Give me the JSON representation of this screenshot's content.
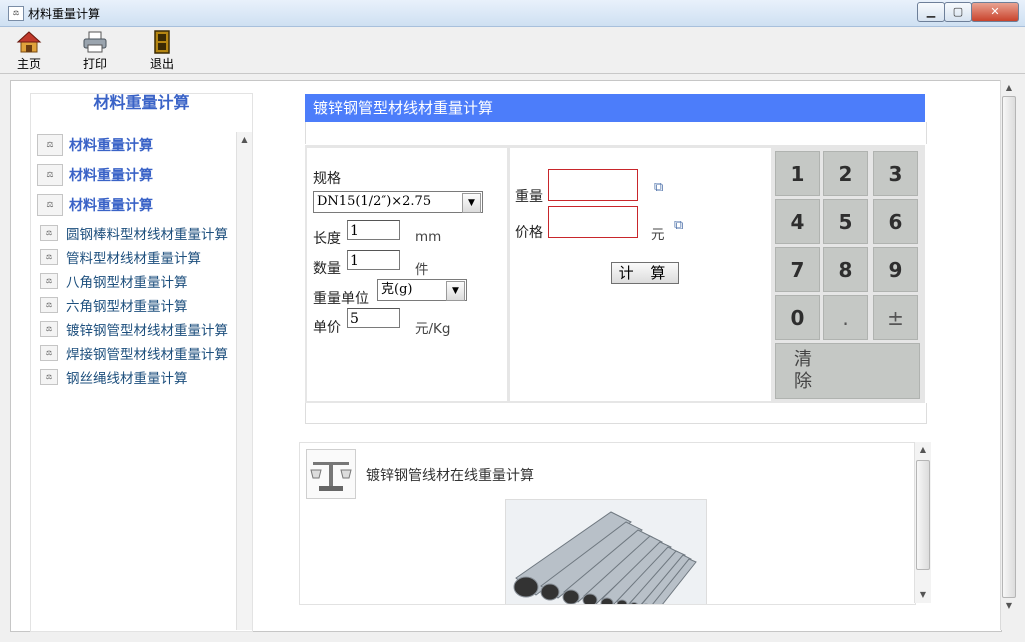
{
  "window": {
    "title": "材料重量计算",
    "app_icon": "scale-icon",
    "buttons": [
      "minimize-icon",
      "maximize-icon",
      "close-icon"
    ]
  },
  "toolbar": {
    "home_label": "主页",
    "print_label": "打印",
    "exit_label": "退出"
  },
  "sidebar": {
    "title": "材料重量计算",
    "items": [
      {
        "label": "材料重量计算",
        "size": "large"
      },
      {
        "label": "材料重量计算",
        "size": "large"
      },
      {
        "label": "材料重量计算",
        "size": "large"
      },
      {
        "label": "圆钢棒料型材线材重量计算",
        "size": "small"
      },
      {
        "label": "管料型材线材重量计算",
        "size": "small"
      },
      {
        "label": "八角钢型材重量计算",
        "size": "small"
      },
      {
        "label": "六角钢型材重量计算",
        "size": "small"
      },
      {
        "label": "镀锌钢管型材线材重量计算",
        "size": "small"
      },
      {
        "label": "焊接钢管型材线材重量计算",
        "size": "small"
      },
      {
        "label": "钢丝绳线材重量计算",
        "size": "small"
      }
    ]
  },
  "calculator": {
    "header": "镀锌钢管型材线材重量计算",
    "spec_label": "规格",
    "spec_value": "DN15(1/2″)×2.75",
    "length_label": "长度",
    "length_value": "1",
    "length_unit": "mm",
    "quantity_label": "数量",
    "quantity_value": "1",
    "quantity_unit": "件",
    "weight_unit_label": "重量单位",
    "weight_unit_value": "克(g)",
    "unit_price_label": "单价",
    "unit_price_value": "5",
    "unit_price_unit": "元/Kg",
    "weight_result_label": "重量",
    "weight_result_value": "",
    "price_result_label": "价格",
    "price_result_value": "",
    "price_unit": "元",
    "calc_button": "计 算"
  },
  "keypad": {
    "keys": [
      "1",
      "2",
      "3",
      "4",
      "5",
      "6",
      "7",
      "8",
      "9",
      "0",
      ".",
      "±"
    ],
    "clear": "清除"
  },
  "bottom_panel": {
    "title": "镀锌钢管线材在线重量计算"
  },
  "colors": {
    "header_blue": "#4c7dfa",
    "sidebar_big": "#3a63c7",
    "sidebar_small": "#1d4f7d",
    "result_border": "#c8262b"
  }
}
